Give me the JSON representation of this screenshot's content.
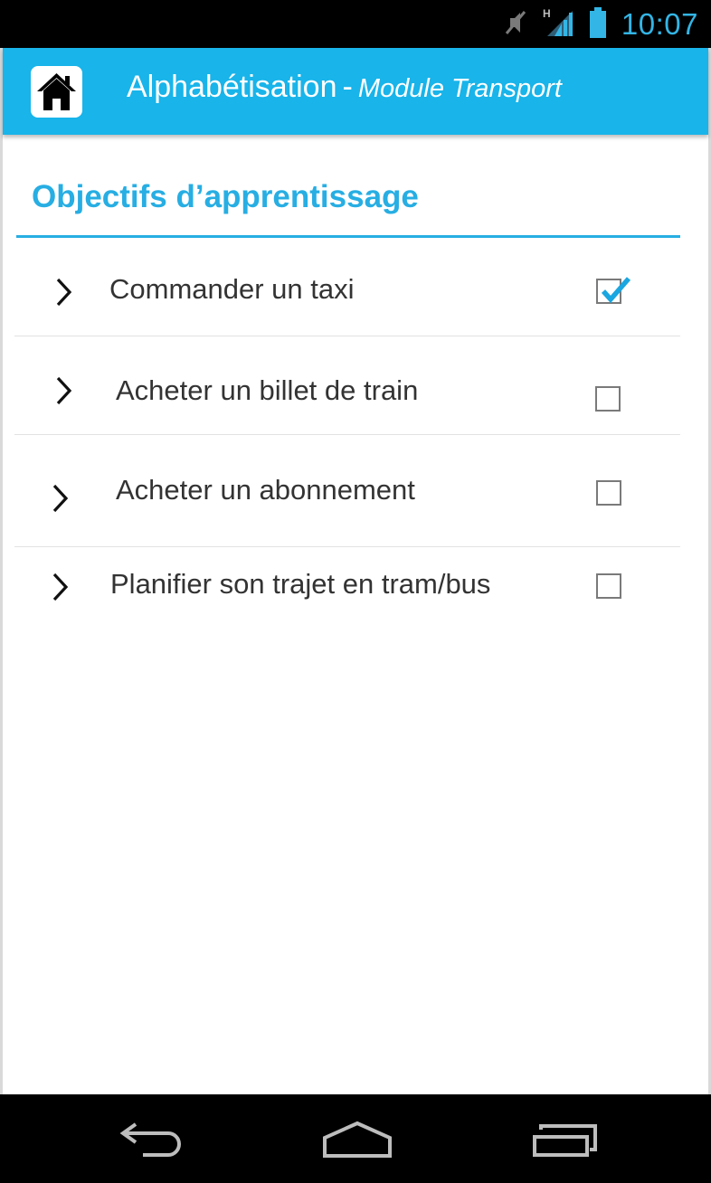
{
  "status_bar": {
    "time": "10:07",
    "icons": [
      "mute-icon",
      "signal-h-icon",
      "battery-icon"
    ],
    "accent_color": "#33b5e5"
  },
  "action_bar": {
    "color": "#18b4ea",
    "home_icon": "home-icon",
    "title": "Alphabétisation",
    "separator": "-",
    "module": "Module Transport"
  },
  "section": {
    "title": "Objectifs d’apprentissage",
    "color": "#27aee3"
  },
  "objectives": [
    {
      "label": "Commander un taxi",
      "checked": true
    },
    {
      "label": "Acheter un billet de train",
      "checked": false
    },
    {
      "label": "Acheter un abonnement",
      "checked": false
    },
    {
      "label": "Planifier son trajet en tram/bus",
      "checked": false
    }
  ],
  "nav_bar": {
    "buttons": [
      "back-icon",
      "home-nav-icon",
      "recent-apps-icon"
    ]
  }
}
